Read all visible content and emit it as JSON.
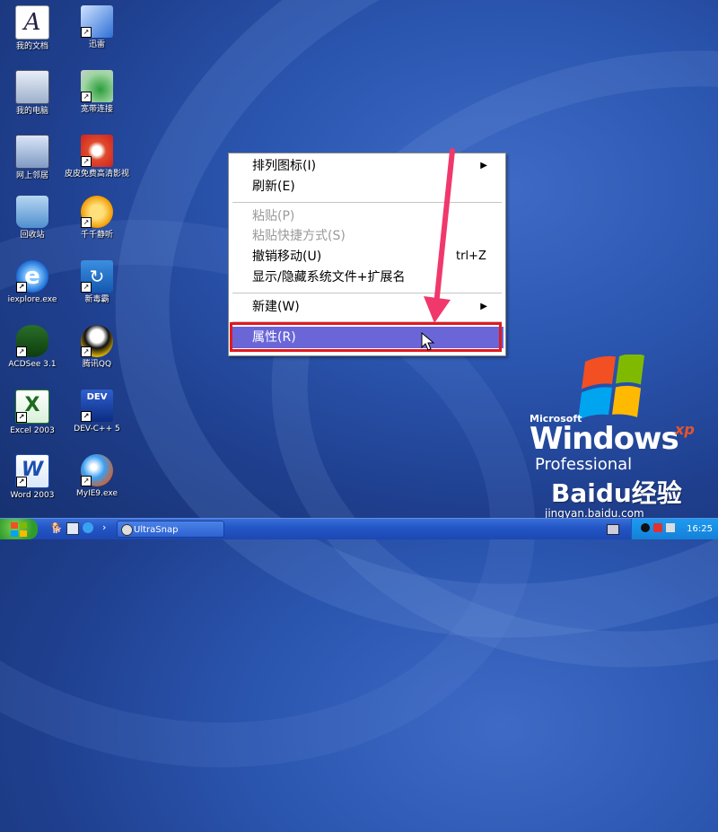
{
  "desktop": {
    "icons": [
      {
        "label": "我的文档",
        "name": "my-documents-icon"
      },
      {
        "label": "迅雷",
        "name": "thunder-icon"
      },
      {
        "label": "我的电脑",
        "name": "my-computer-icon"
      },
      {
        "label": "宽带连接",
        "name": "broadband-icon"
      },
      {
        "label": "网上邻居",
        "name": "network-icon"
      },
      {
        "label": "皮皮免费高清影视",
        "name": "pipi-video-icon"
      },
      {
        "label": "回收站",
        "name": "recycle-bin-icon"
      },
      {
        "label": "千千静听",
        "name": "ttplayer-icon"
      },
      {
        "label": "iexplore.exe",
        "name": "ie-icon"
      },
      {
        "label": "新毒霸",
        "name": "duba-icon"
      },
      {
        "label": "ACDSee 3.1",
        "name": "acdsee-icon"
      },
      {
        "label": "腾讯QQ",
        "name": "qq-icon"
      },
      {
        "label": "Excel 2003",
        "name": "excel-icon"
      },
      {
        "label": "DEV-C++ 5",
        "name": "devcpp-icon"
      },
      {
        "label": "Word 2003",
        "name": "word-icon"
      },
      {
        "label": "MyIE9.exe",
        "name": "myie9-icon"
      }
    ]
  },
  "context_menu": {
    "arrange": "排列图标(I)",
    "refresh": "刷新(E)",
    "paste": "粘贴(P)",
    "paste_shortcut": "粘贴快捷方式(S)",
    "undo_move": "撤销移动(U)",
    "undo_shortcut": "trl+Z",
    "show_hide": "显示/隐藏系统文件+扩展名",
    "new": "新建(W)",
    "properties": "属性(R)"
  },
  "windows_logo": {
    "brand": "Microsoft",
    "product": "Windows",
    "edition": "Professional",
    "xp": "xp"
  },
  "watermark": {
    "brand": "Baidu经验",
    "url": "jingyan.baidu.com"
  },
  "taskbar": {
    "task": "UltraSnap",
    "clock": "16:25"
  },
  "colors": {
    "highlight": "#6b66d8",
    "annotation": "#e0191f",
    "arrow": "#f0386c"
  }
}
